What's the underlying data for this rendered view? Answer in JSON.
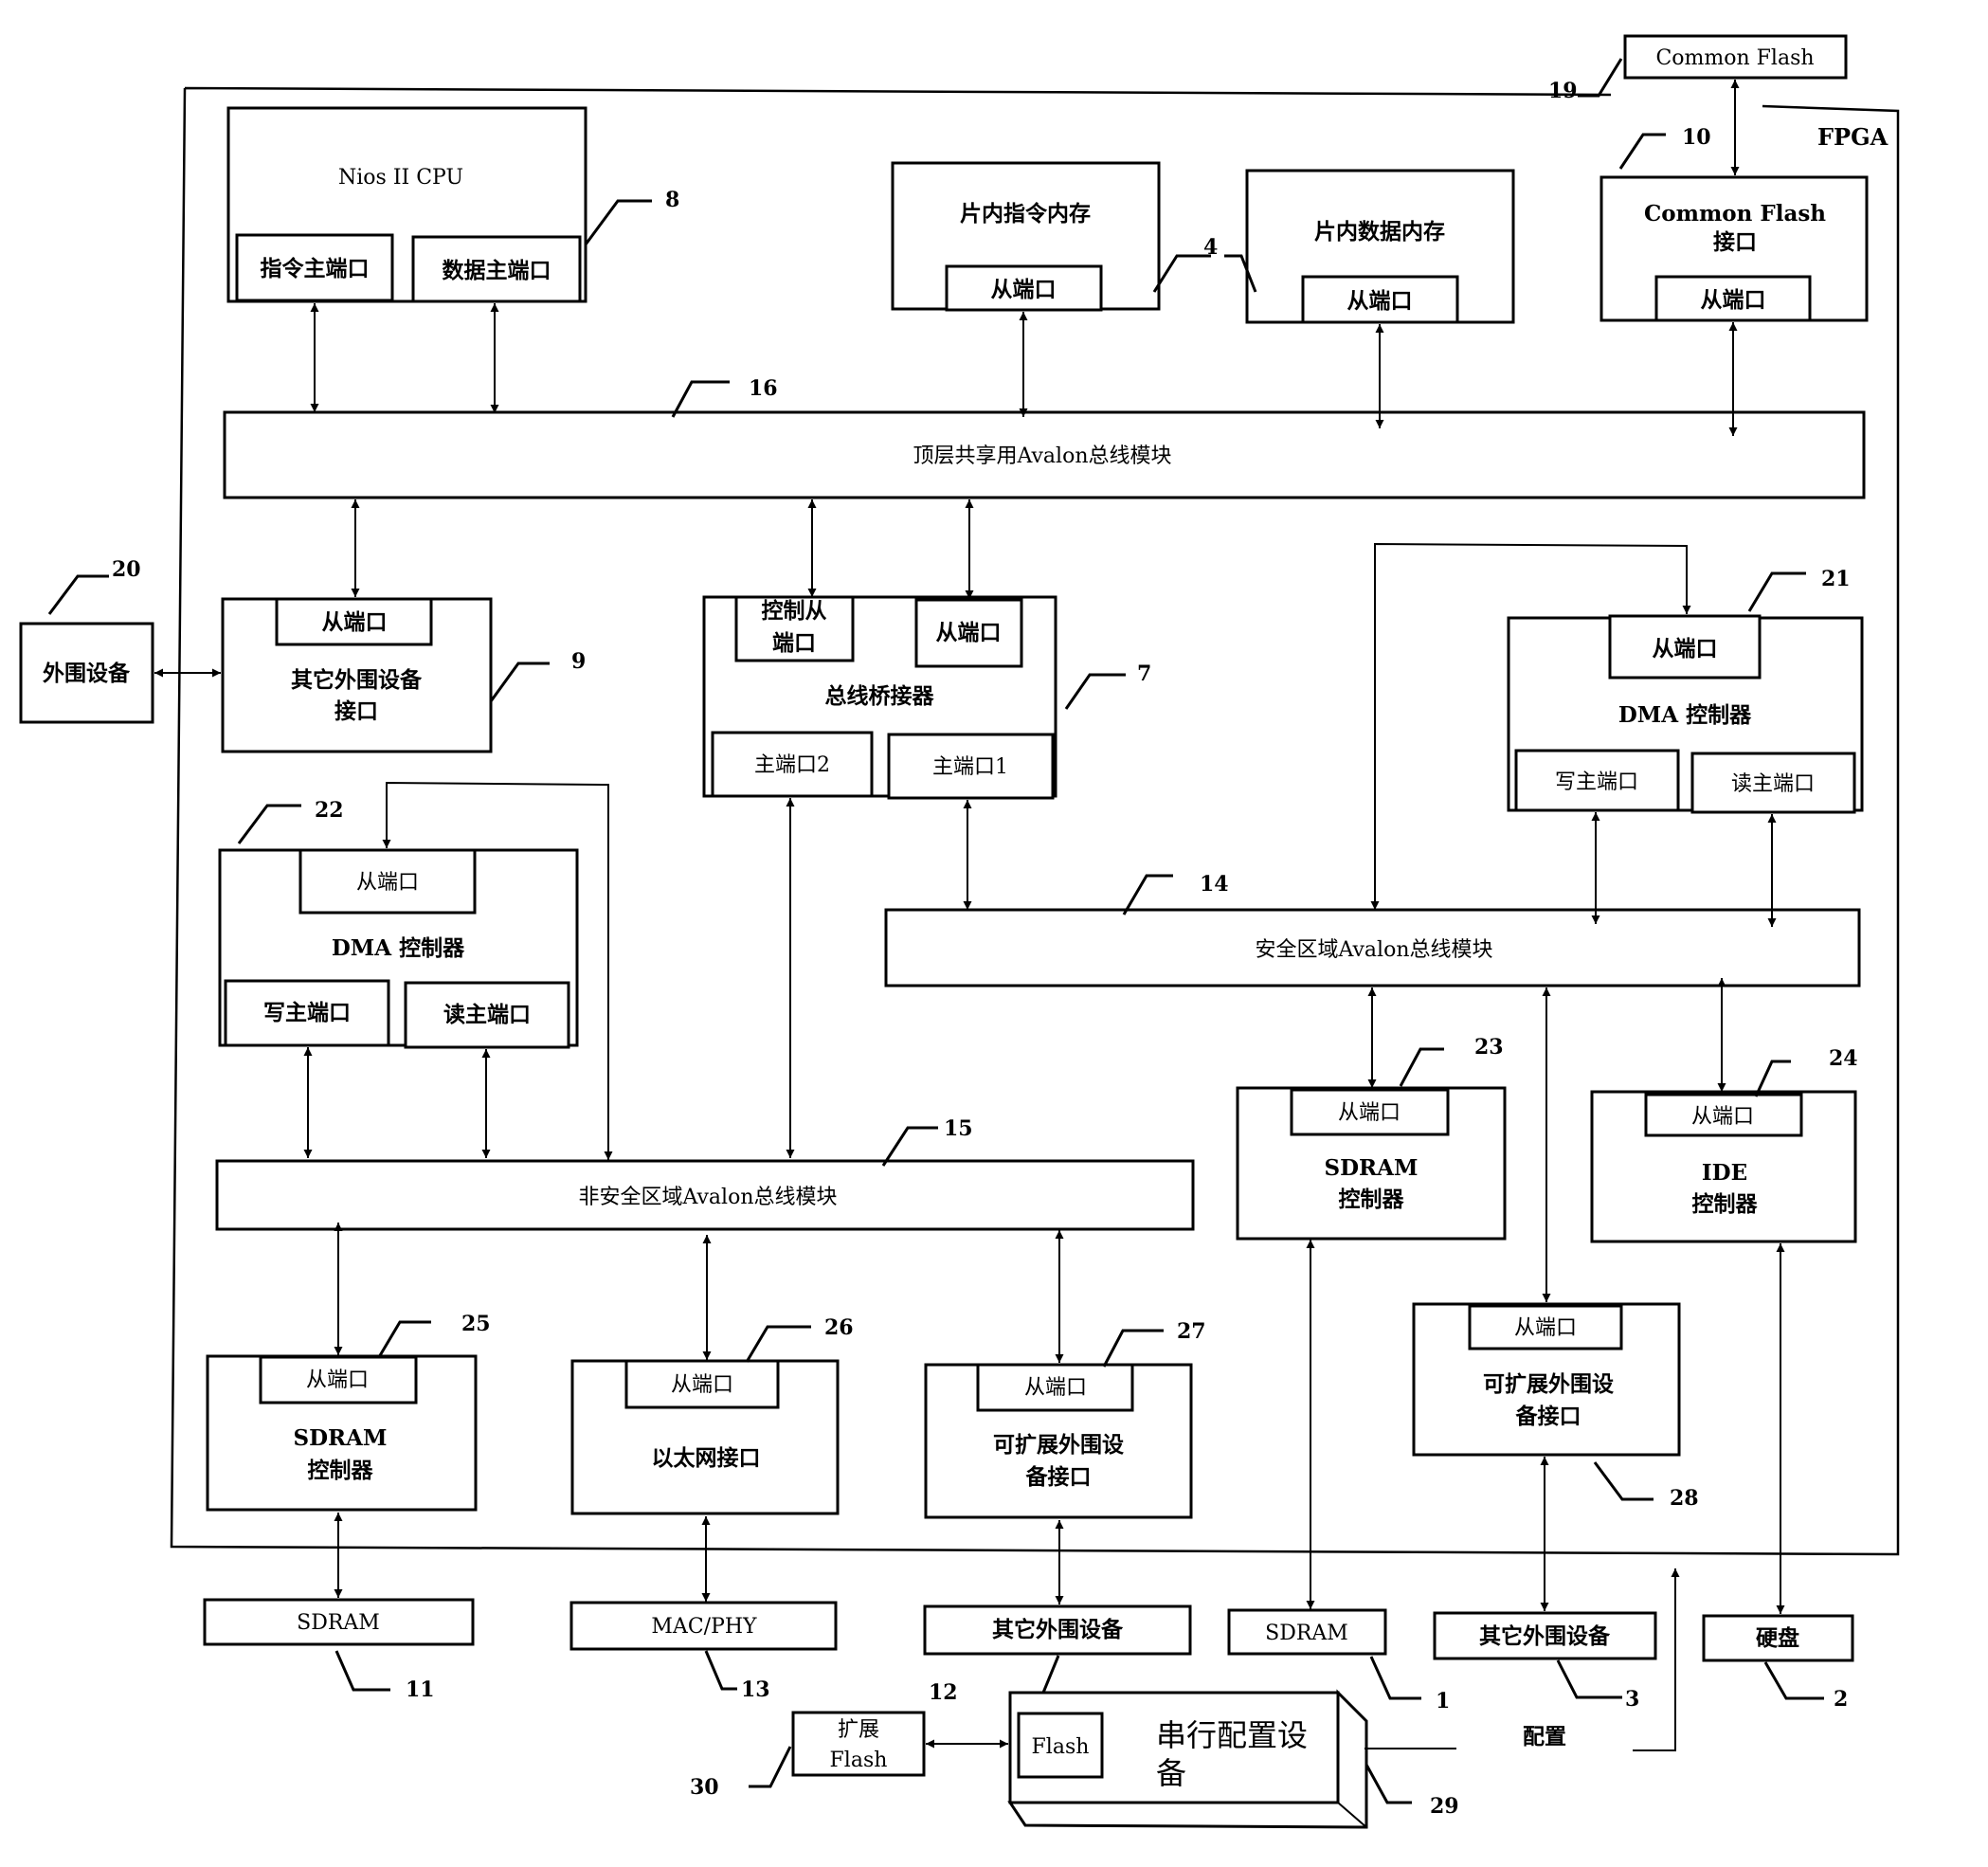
{
  "diagram": {
    "fpga_label": "FPGA",
    "ref_numbers": {
      "nios_cpu": "8",
      "onchip_memory": "4",
      "flash_interface": "10",
      "common_flash_ext": "19",
      "top_bus": "16",
      "peripheral_ext": "20",
      "other_peripheral_interface": "9",
      "bus_bridge": "7",
      "dma_secure": "21",
      "dma_nonsecure": "22",
      "secure_bus": "14",
      "nonsecure_bus": "15",
      "sdram_ctrl_secure": "23",
      "ide_ctrl": "24",
      "sdram_ctrl_nonsecure": "25",
      "ethernet": "26",
      "expansion_nonsecure": "27",
      "expansion_secure": "28",
      "sdram_ext_nonsecure": "11",
      "mac_phy": "13",
      "other_peripheral_nonsecure": "12",
      "sdram_ext_secure": "1",
      "other_peripheral_secure": "3",
      "hard_disk": "2",
      "serial_config": "29",
      "expansion_flash": "30"
    },
    "nios_cpu": {
      "title": "Nios II CPU",
      "instr_port": "指令主端口",
      "data_port": "数据主端口"
    },
    "onchip_instr_mem": {
      "title": "片内指令内存",
      "slave_port": "从端口"
    },
    "onchip_data_mem": {
      "title": "片内数据内存",
      "slave_port": "从端口"
    },
    "common_flash_ext": {
      "title": "Common Flash"
    },
    "common_flash_interface": {
      "title_line1": "Common Flash",
      "title_line2": "接口",
      "slave_port": "从端口"
    },
    "top_bus": {
      "title": "顶层共享用Avalon总线模块"
    },
    "peripheral_ext": {
      "title": "外围设备"
    },
    "other_peripheral_interface": {
      "slave_port": "从端口",
      "title_line1": "其它外围设备",
      "title_line2": "接口"
    },
    "bus_bridge": {
      "ctrl_slave_line1": "控制从",
      "ctrl_slave_line2": "端口",
      "slave_port": "从端口",
      "title": "总线桥接器",
      "master2": "主端口2",
      "master1": "主端口1"
    },
    "dma_secure": {
      "slave_port": "从端口",
      "title": "DMA 控制器",
      "write_port": "写主端口",
      "read_port": "读主端口"
    },
    "dma_nonsecure": {
      "slave_port": "从端口",
      "title": "DMA 控制器",
      "write_port": "写主端口",
      "read_port": "读主端口"
    },
    "secure_bus": {
      "title": "安全区域Avalon总线模块"
    },
    "nonsecure_bus": {
      "title": "非安全区域Avalon总线模块"
    },
    "sdram_ctrl_secure": {
      "slave_port": "从端口",
      "title_line1": "SDRAM",
      "title_line2": "控制器"
    },
    "ide_ctrl": {
      "slave_port": "从端口",
      "title_line1": "IDE",
      "title_line2": "控制器"
    },
    "expansion_secure": {
      "slave_port": "从端口",
      "title_line1": "可扩展外围设",
      "title_line2": "备接口"
    },
    "sdram_ctrl_nonsecure": {
      "slave_port": "从端口",
      "title_line1": "SDRAM",
      "title_line2": "控制器"
    },
    "ethernet": {
      "slave_port": "从端口",
      "title": "以太网接口"
    },
    "expansion_nonsecure": {
      "slave_port": "从端口",
      "title_line1": "可扩展外围设",
      "title_line2": "备接口"
    },
    "external": {
      "sdram_nonsecure": "SDRAM",
      "mac_phy": "MAC/PHY",
      "other_peripheral_nonsecure": "其它外围设备",
      "sdram_secure": "SDRAM",
      "other_peripheral_secure": "其它外围设备",
      "hard_disk": "硬盘"
    },
    "expansion_flash": {
      "line1": "扩展",
      "line2": "Flash"
    },
    "serial_config": {
      "flash": "Flash",
      "title_line1": "串行配置设",
      "title_line2": "备"
    },
    "config_label": "配置"
  }
}
